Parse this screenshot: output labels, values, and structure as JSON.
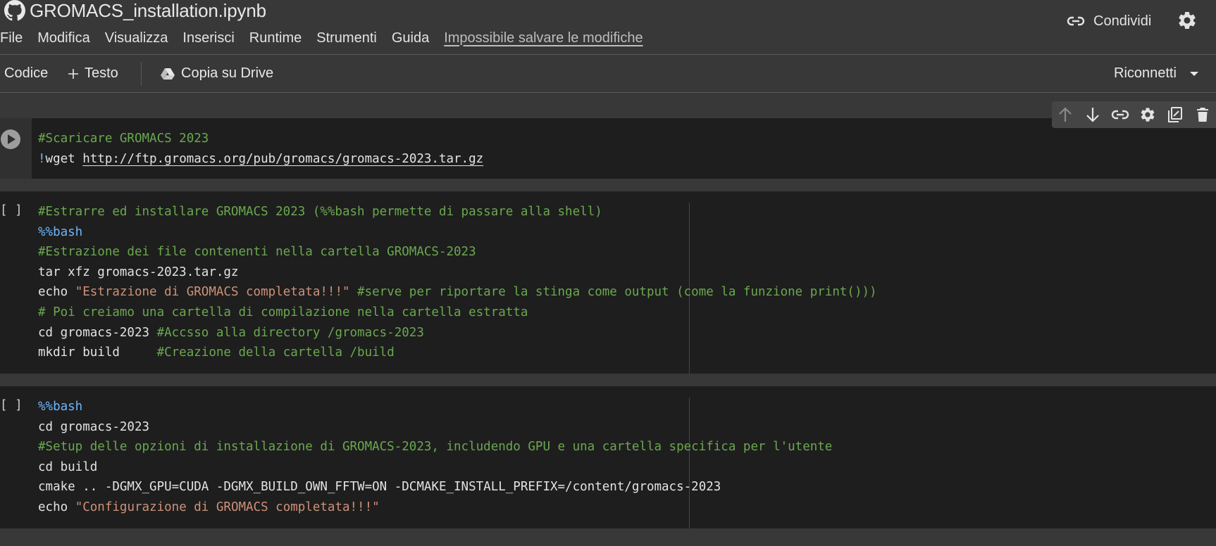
{
  "window": {
    "title": "GROMACS_installation.ipynb"
  },
  "menu": {
    "items": [
      "File",
      "Modifica",
      "Visualizza",
      "Inserisci",
      "Runtime",
      "Strumenti",
      "Guida"
    ],
    "status": "Impossibile salvare le modifiche"
  },
  "header": {
    "share_label": "Condividi"
  },
  "toolbar": {
    "code_label": "Codice",
    "text_label": "Testo",
    "drive_label": "Copia su Drive",
    "reconnect_label": "Riconnetti"
  },
  "cells": [
    {
      "bracket": "",
      "lines": [
        [
          {
            "t": "#Scaricare GROMACS 2023",
            "k": "c"
          }
        ],
        [
          {
            "t": "!",
            "k": "m"
          },
          {
            "t": "wget ",
            "k": ""
          },
          {
            "t": "http://ftp.gromacs.org/pub/gromacs/gromacs-2023.tar.gz",
            "k": "u"
          }
        ]
      ]
    },
    {
      "bracket": "[ ]",
      "lines": [
        [
          {
            "t": "#Estrarre ed installare GROMACS 2023 (%%bash permette di passare alla shell)",
            "k": "c"
          }
        ],
        [
          {
            "t": "%%bash",
            "k": "m"
          }
        ],
        [
          {
            "t": "#Estrazione dei file contenenti nella cartella GROMACS-2023",
            "k": "c"
          }
        ],
        [
          {
            "t": "tar xfz gromacs-2023.tar.gz",
            "k": ""
          }
        ],
        [
          {
            "t": "echo ",
            "k": ""
          },
          {
            "t": "\"Estrazione di GROMACS completata!!!\"",
            "k": "s"
          },
          {
            "t": " #serve per riportare la stinga come output (come la funzione print()))",
            "k": "c"
          }
        ],
        [
          {
            "t": "# Poi creiamo una cartella di compilazione nella cartella estratta",
            "k": "c"
          }
        ],
        [
          {
            "t": "cd gromacs-2023 ",
            "k": ""
          },
          {
            "t": "#Accsso alla directory /gromacs-2023",
            "k": "c"
          }
        ],
        [
          {
            "t": "mkdir build     ",
            "k": ""
          },
          {
            "t": "#Creazione della cartella /build",
            "k": "c"
          }
        ]
      ]
    },
    {
      "bracket": "[ ]",
      "lines": [
        [
          {
            "t": "%%bash",
            "k": "m"
          }
        ],
        [
          {
            "t": "cd gromacs-2023",
            "k": ""
          }
        ],
        [
          {
            "t": "#Setup delle opzioni di installazione di GROMACS-2023, includendo GPU e una cartella specifica per l'utente",
            "k": "c"
          }
        ],
        [
          {
            "t": "cd build",
            "k": ""
          }
        ],
        [
          {
            "t": "cmake .. -DGMX_GPU=CUDA -DGMX_BUILD_OWN_FFTW=ON -DCMAKE_INSTALL_PREFIX=/content/gromacs-2023",
            "k": ""
          }
        ],
        [
          {
            "t": "echo ",
            "k": ""
          },
          {
            "t": "\"Configurazione di GROMACS completata!!!\"",
            "k": "s"
          }
        ]
      ]
    }
  ]
}
